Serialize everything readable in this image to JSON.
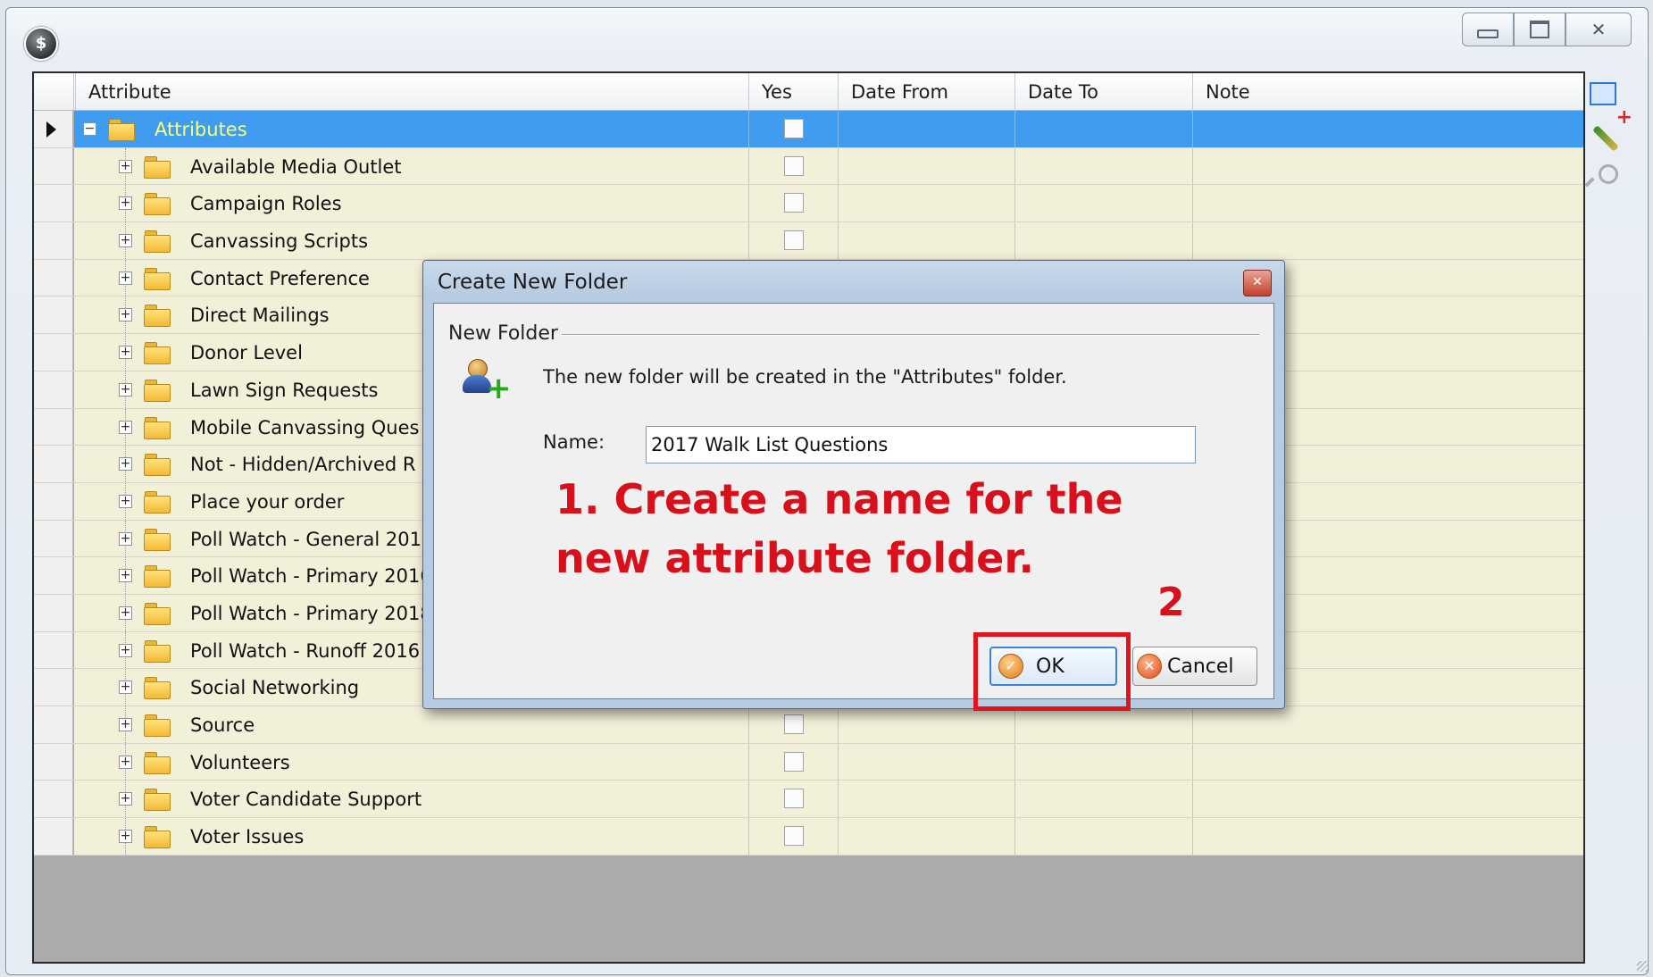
{
  "window": {
    "app_icon": "app-globe-icon",
    "controls": [
      "minimize-icon",
      "maximize-icon",
      "close-icon"
    ]
  },
  "grid": {
    "columns": [
      "Attribute",
      "Yes",
      "Date From",
      "Date To",
      "Note"
    ],
    "root": {
      "label": "Attributes",
      "expanded": true,
      "yes": false
    },
    "items": [
      {
        "label": "Available Media Outlet",
        "yes": false
      },
      {
        "label": "Campaign Roles",
        "yes": false
      },
      {
        "label": "Canvassing Scripts",
        "yes": false
      },
      {
        "label": "Contact Preference",
        "yes": false
      },
      {
        "label": "Direct Mailings",
        "yes": false
      },
      {
        "label": "Donor Level",
        "yes": false
      },
      {
        "label": "Lawn Sign Requests",
        "yes": false
      },
      {
        "label": "Mobile Canvassing Ques",
        "yes": false
      },
      {
        "label": "Not - Hidden/Archived R",
        "yes": false
      },
      {
        "label": "Place your order",
        "yes": false
      },
      {
        "label": "Poll Watch - General 201",
        "yes": false
      },
      {
        "label": "Poll Watch - Primary 2016",
        "yes": false
      },
      {
        "label": "Poll Watch - Primary 2018",
        "yes": false
      },
      {
        "label": "Poll Watch - Runoff 2016",
        "yes": false
      },
      {
        "label": "Social Networking",
        "yes": false
      },
      {
        "label": "Source",
        "yes": false
      },
      {
        "label": "Volunteers",
        "yes": false
      },
      {
        "label": "Voter Candidate Support",
        "yes": false
      },
      {
        "label": "Voter Issues",
        "yes": false
      }
    ]
  },
  "toolbar": {
    "icons": [
      "new-folder-icon",
      "edit-icon",
      "search-icon"
    ]
  },
  "dialog": {
    "title": "Create New Folder",
    "group_label": "New Folder",
    "info": "The new folder will be created in the \"Attributes\" folder.",
    "name_label": "Name:",
    "name_value": "2017 Walk List Questions",
    "ok_label": "OK",
    "cancel_label": "Cancel"
  },
  "annotations": {
    "step1": "1. Create a name for the new attribute folder.",
    "step2": "2"
  },
  "colors": {
    "selected_row": "#3f9cf0",
    "row_background": "#f2f0d9",
    "annotation_red": "#d8101c"
  }
}
